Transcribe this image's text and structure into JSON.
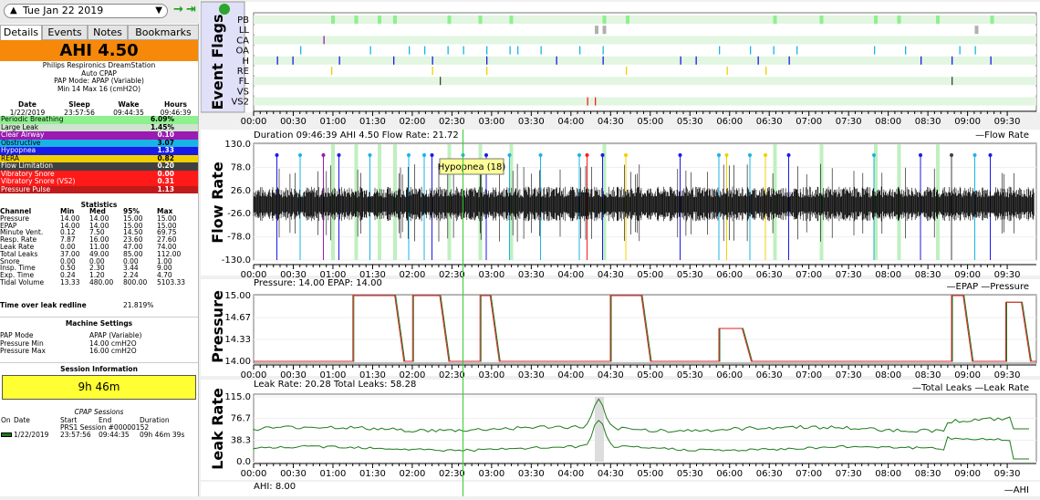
{
  "nav": {
    "date": "Tue Jan 22 2019"
  },
  "tabs": [
    "Details",
    "Events",
    "Notes",
    "Bookmarks"
  ],
  "ahi": "AHI 4.50",
  "machine": [
    "Philips Respironics DreamStation",
    "Auto CPAP",
    "PAP Mode: APAP (Variable)",
    "Min 14 Max 16 (cmH2O)"
  ],
  "summary": {
    "headers": [
      "Date",
      "Sleep",
      "Wake",
      "Hours"
    ],
    "values": [
      "1/22/2019",
      "23:57:56",
      "09:44:35",
      "09:46:39"
    ]
  },
  "events": [
    {
      "label": "Periodic Breathing",
      "value": "6.09%",
      "color": "#8ef08e"
    },
    {
      "label": "Large Leak",
      "value": "1.45%",
      "color": "#cfe3cf"
    },
    {
      "label": "Clear Airway",
      "value": "0.10",
      "color": "#9b1ab2"
    },
    {
      "label": "Obstructive",
      "value": "3.07",
      "color": "#1ab3e6"
    },
    {
      "label": "Hypopnea",
      "value": "1.33",
      "color": "#1a1ae6"
    },
    {
      "label": "RERA",
      "value": "0.82",
      "color": "#f0d000"
    },
    {
      "label": "Flow Limitation",
      "value": "0.20",
      "color": "#404040"
    },
    {
      "label": "Vibratory Snore",
      "value": "0.00",
      "color": "#ff1a1a"
    },
    {
      "label": "Vibratory Snore (VS2)",
      "value": "0.31",
      "color": "#ff1a1a"
    },
    {
      "label": "Pressure Pulse",
      "value": "1.13",
      "color": "#c01a1a"
    }
  ],
  "stats_title": "Statistics",
  "stats_headers": [
    "Channel",
    "Min",
    "Med",
    "95%",
    "Max"
  ],
  "stats": [
    [
      "Pressure",
      "14.00",
      "14.00",
      "15.00",
      "15.00"
    ],
    [
      "EPAP",
      "14.00",
      "14.00",
      "15.00",
      "15.00"
    ],
    [
      "Minute Vent.",
      "0.12",
      "7.50",
      "14.50",
      "69.75"
    ],
    [
      "Resp. Rate",
      "7.87",
      "16.00",
      "23.60",
      "27.60"
    ],
    [
      "Leak Rate",
      "0.00",
      "11.00",
      "47.00",
      "74.00"
    ],
    [
      "Total Leaks",
      "37.00",
      "49.00",
      "85.00",
      "112.00"
    ],
    [
      "Snore",
      "0.00",
      "0.00",
      "0.00",
      "1.00"
    ],
    [
      "Insp. Time",
      "0.50",
      "2.30",
      "3.44",
      "9.00"
    ],
    [
      "Exp. Time",
      "0.24",
      "1.20",
      "2.24",
      "4.70"
    ],
    [
      "Tidal Volume",
      "13.33",
      "480.00",
      "800.00",
      "5103.33"
    ]
  ],
  "redline": {
    "label": "Time over leak redline",
    "value": "21.819%"
  },
  "machine_settings": {
    "title": "Machine Settings",
    "rows": [
      [
        "PAP Mode",
        "APAP (Variable)"
      ],
      [
        "Pressure Min",
        "14.00 cmH2O"
      ],
      [
        "Pressure Max",
        "16.00 cmH2O"
      ]
    ]
  },
  "session_info": {
    "title": "Session Information",
    "duration": "9h 46m",
    "cpap_title": "CPAP Sessions",
    "headers": [
      "On",
      "Date",
      "Start",
      "End",
      "Duration"
    ],
    "session_name": "PRS1 Session #00000152",
    "row": [
      "1/22/2019",
      "23:57:56",
      "09:44:35",
      "09h 46m 39s"
    ]
  },
  "time_ticks": [
    "00:00",
    "00:30",
    "01:00",
    "01:30",
    "02:00",
    "02:30",
    "03:00",
    "03:30",
    "04:00",
    "04:30",
    "05:00",
    "05:30",
    "06:00",
    "06:30",
    "07:00",
    "07:30",
    "08:00",
    "08:30",
    "09:00",
    "09:30"
  ],
  "event_flags": {
    "title": "Event Flags",
    "rows": [
      "PB",
      "LL",
      "CA",
      "OA",
      "H",
      "RE",
      "FL",
      "VS",
      "VS2"
    ]
  },
  "flow": {
    "title": "Flow Rate",
    "header": "Duration 09:46:39 AHI 4.50 Flow Rate: 21.72",
    "legend": "Flow Rate",
    "yticks": [
      "130.0",
      "78.0",
      "26.0",
      "-26.0",
      "-78.0",
      "-130.0"
    ],
    "tooltip": "Hypopnea (18)"
  },
  "pressure": {
    "title": "Pressure",
    "header": "Pressure: 14.00 EPAP: 14.00",
    "legend": [
      "EPAP",
      "Pressure"
    ],
    "yticks": [
      "15.00",
      "14.67",
      "14.33",
      "14.00"
    ]
  },
  "leak": {
    "title": "Leak Rate",
    "header": "Leak Rate: 20.28 Total Leaks: 58.28",
    "legend": [
      "Total Leaks",
      "Leak Rate"
    ],
    "yticks": [
      "115.0",
      "76.7",
      "38.3",
      "0.0"
    ]
  },
  "ahi_panel": {
    "header": "AHI: 8.00",
    "legend": "AHI"
  },
  "colors": {
    "pb": "#8ef08e",
    "ll": "#b0b0b0",
    "oa": "#1ab3e6",
    "h": "#1a1ae6",
    "ca": "#9b1ab2",
    "re": "#f0d000",
    "fl": "#404040",
    "vs2": "#ff1a1a",
    "cursor": "#33cc33",
    "total": "#1d7a1d",
    "leak": "#1d7a1d"
  }
}
